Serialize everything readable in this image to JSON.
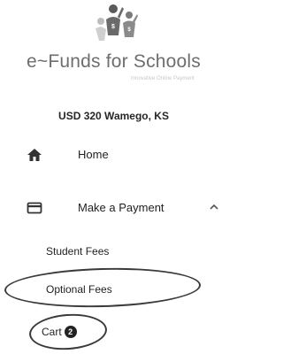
{
  "brand": {
    "name": "e~Funds for Schools",
    "tagline": "Innovative Online Payment",
    "logo_icon": "children-logo-icon"
  },
  "district": "USD 320 Wamego, KS",
  "nav": {
    "home": {
      "label": "Home",
      "icon": "home-icon"
    },
    "make_payment": {
      "label": "Make a Payment",
      "icon": "credit-card-icon",
      "expanded": true,
      "chevron": "chevron-up-icon",
      "sub_items": [
        {
          "label": "Student Fees"
        },
        {
          "label": "Optional Fees"
        }
      ]
    },
    "cart": {
      "label": "Cart",
      "count": "2"
    }
  },
  "colors": {
    "text": "#1f1f1f",
    "brand_text": "#6e6e6e",
    "logo_primary": "#5a5a5a",
    "logo_secondary": "#9a9a9a",
    "badge_bg": "#222222",
    "annotation_circle": "#3a3a3a"
  }
}
